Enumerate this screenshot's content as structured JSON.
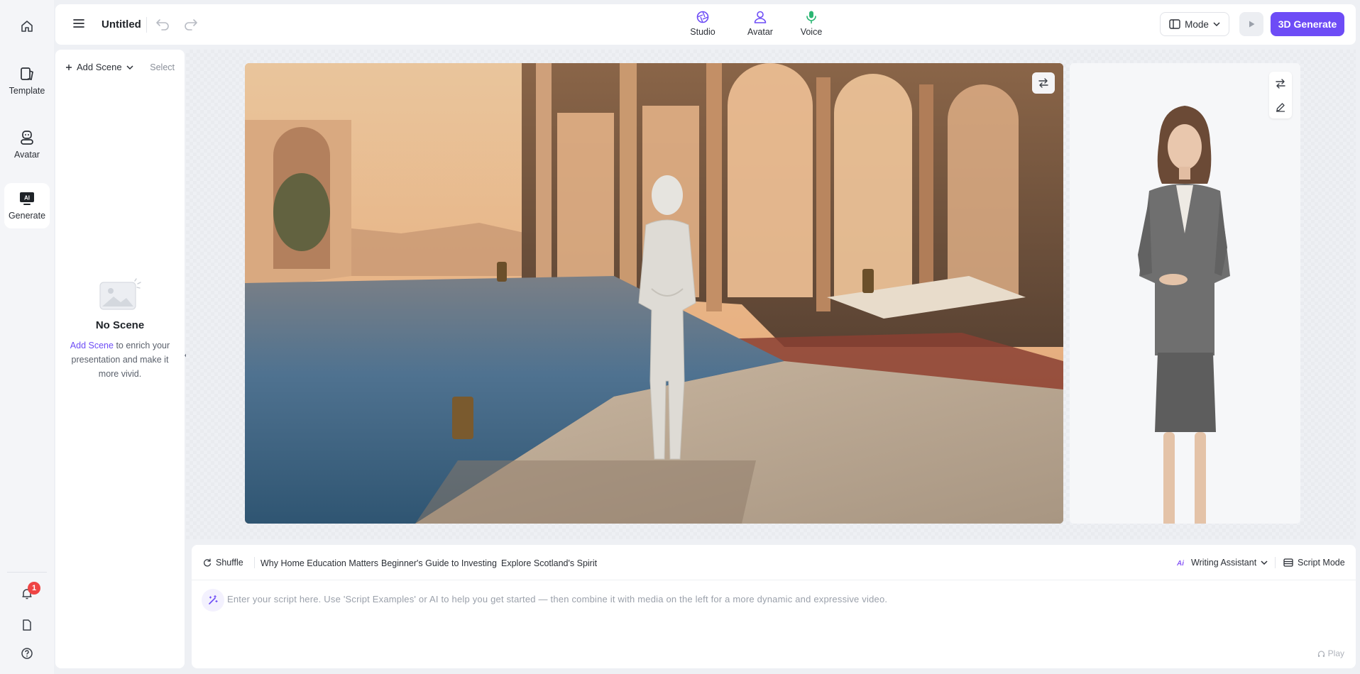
{
  "app": {
    "doc_title": "Untitled"
  },
  "rail": {
    "items": [
      {
        "label": "Template",
        "icon": "template-icon"
      },
      {
        "label": "Avatar",
        "icon": "avatar-icon"
      },
      {
        "label": "Generate",
        "icon": "ai-generate-icon"
      }
    ],
    "notification_count": "1"
  },
  "top_tabs": [
    {
      "label": "Studio",
      "icon": "studio-icon"
    },
    {
      "label": "Avatar",
      "icon": "person-icon"
    },
    {
      "label": "Voice",
      "icon": "microphone-icon"
    }
  ],
  "toolbar": {
    "mode_label": "Mode",
    "generate_label": "3D Generate"
  },
  "scenes": {
    "add_label": "Add Scene",
    "select_label": "Select",
    "empty_title": "No Scene",
    "empty_link": "Add Scene",
    "empty_desc": " to enrich your presentation and make it more vivid."
  },
  "script": {
    "shuffle_label": "Shuffle",
    "examples": [
      "Why Home Education Matters",
      "Beginner's Guide to Investing",
      "Explore Scotland's Spirit"
    ],
    "writing_assistant_label": "Writing Assistant",
    "script_mode_label": "Script Mode",
    "placeholder": "Enter your script here. Use 'Script Examples' or AI to help you get started — then combine it with media on the left for a more dynamic and expressive video.",
    "play_label": "Play"
  },
  "colors": {
    "accent": "#6d4cf6",
    "badge": "#ef4444"
  }
}
